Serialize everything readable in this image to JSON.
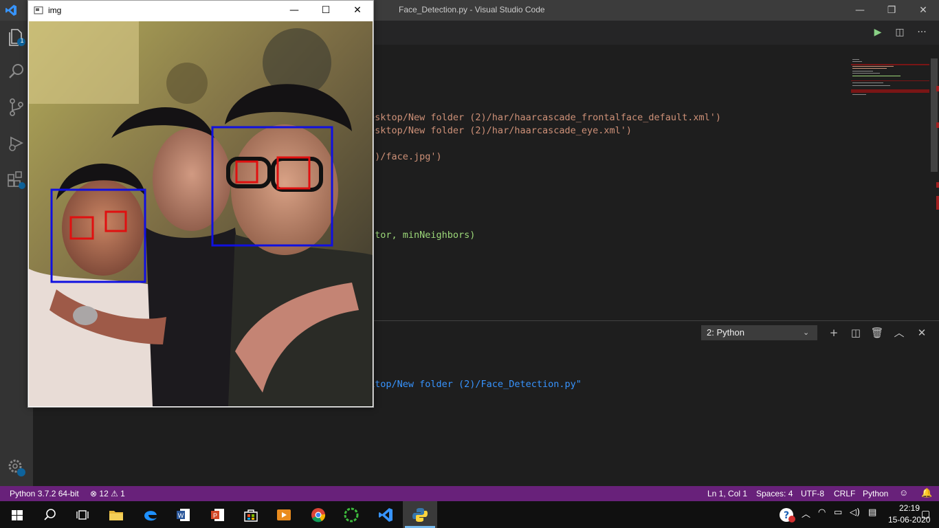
{
  "vscode": {
    "window_title": "Face_Detection.py - Visual Studio Code",
    "explorer_badge": "1",
    "code_lines": [
      "esktop/New folder (2)/har/haarcascade_frontalface_default.xml')",
      "esktop/New folder (2)/har/haarcascade_eye.xml')",
      "2)/face.jpg')",
      "ctor, minNeighbors)"
    ],
    "terminal": {
      "selected": "2: Python",
      "line": "ktop/New folder (2)/Face_Detection.py\""
    }
  },
  "statusbar": {
    "interpreter": "Python 3.7.2 64-bit",
    "problems": "⊗ 12 ⚠ 1",
    "position": "Ln 1, Col 1",
    "spaces": "Spaces: 4",
    "encoding": "UTF-8",
    "eol": "CRLF",
    "language": "Python"
  },
  "img_window": {
    "title": "img"
  },
  "taskbar": {
    "time": "22:19",
    "date": "15-06-2020"
  },
  "colors": {
    "accent_status": "#68217a",
    "face_box": "#1010e0",
    "eye_box": "#e01010"
  }
}
